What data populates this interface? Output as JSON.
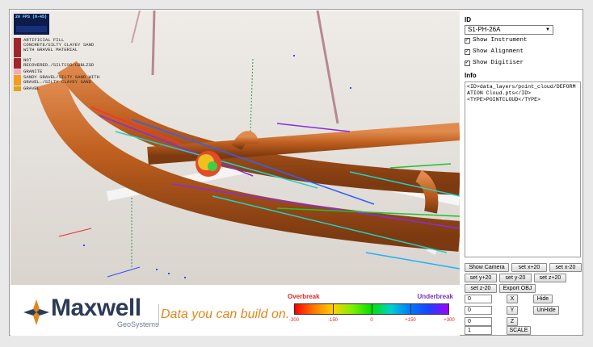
{
  "viewport": {
    "fps_text": "20 FPS (8-45)",
    "legend": [
      {
        "label": "ARTIFICIAL FILL CONCRETE/SILTY CLAYEY SAND WITH GRAVEL MATERIAL",
        "color": "#a1262b"
      },
      {
        "label": "NOT RECOVERED./SILTCSO/CBBLZSD",
        "color": "#a1262b"
      },
      {
        "label": "GRANITE",
        "color": "#f3a9b6"
      },
      {
        "label": "SANDY GRAVEL/SILTY SAND WITH GRAVEL./SILTY CLAYEY SAND",
        "color": "#f39c1f"
      },
      {
        "label": "GRAVEL",
        "color": "#e3a317"
      }
    ]
  },
  "branding": {
    "name": "Maxwell",
    "sub": "GeoSystems",
    "tagline": "Data you can build on."
  },
  "scale": {
    "left_label": "Overbreak",
    "right_label": "Underbreak",
    "ticks": [
      "-300",
      "-150",
      "0",
      "+150",
      "+300"
    ]
  },
  "panel": {
    "id_label": "ID",
    "id_value": "S1-PH-26A",
    "checks": [
      "Show Instrument",
      "Show Alignment",
      "Show Digitiser"
    ],
    "info_label": "Info",
    "info_text": "<ID>data_layers/point_cloud/DEFORMATION Cloud.pts</ID>\n<TYPE>POINTCLOUD</TYPE>",
    "buttons": {
      "show_camera": "Show Camera",
      "set_x_plus": "set x+20",
      "set_x_minus": "set x-20",
      "set_y_plus": "set y+20",
      "set_y_minus": "set y-20",
      "set_z_plus": "set z+20",
      "set_z_minus": "set z-20",
      "export": "Export OBJ",
      "x": "X",
      "y": "Y",
      "z": "Z",
      "hide": "Hide",
      "unhide": "UnHide",
      "scale": "SCALE"
    },
    "inputs": {
      "x": "0",
      "y": "0",
      "z": "0",
      "scale": "1"
    }
  }
}
